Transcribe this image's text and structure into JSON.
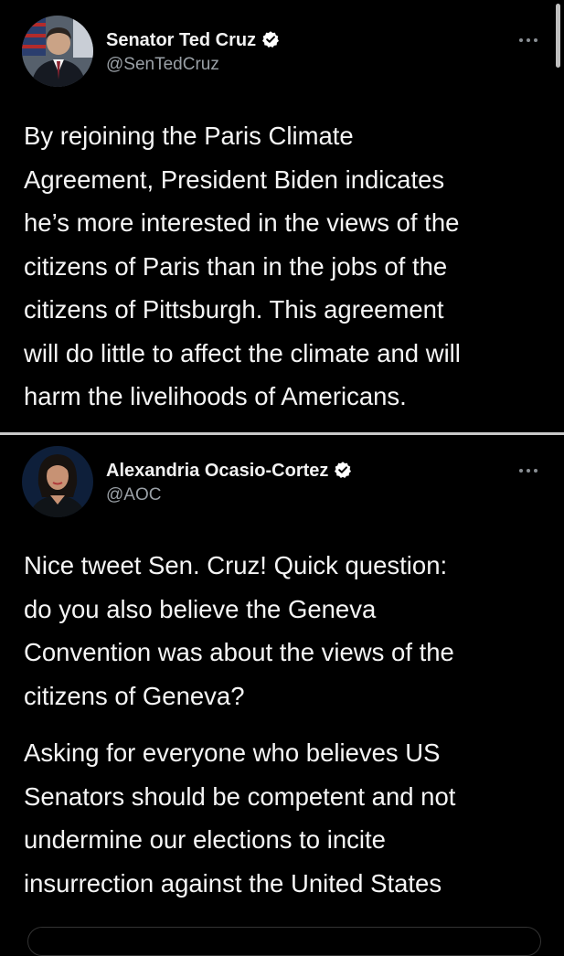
{
  "tweets": [
    {
      "author": {
        "name": "Senator Ted Cruz",
        "handle": "@SenTedCruz",
        "verified": true
      },
      "paragraphs": [
        "By rejoining the Paris Climate\nAgreement, President Biden indicates\nhe’s more interested in the views of the\ncitizens of Paris than in the jobs of the\ncitizens of Pittsburgh. This agreement\nwill do little to affect the climate and will\nharm the livelihoods of Americans."
      ]
    },
    {
      "author": {
        "name": "Alexandria Ocasio-Cortez",
        "handle": "@AOC",
        "verified": true
      },
      "paragraphs": [
        "Nice tweet Sen. Cruz! Quick question:\ndo you also believe the Geneva\nConvention was about the views of the\ncitizens of Geneva?",
        "Asking for everyone who believes US\nSenators should be competent and not\nundermine our elections to incite\ninsurrection against the United States"
      ]
    }
  ],
  "icons": {
    "verified": "verified-badge-icon",
    "more": "more-options-icon"
  },
  "colors": {
    "background": "#000000",
    "text_primary": "#f5f5f5",
    "text_secondary": "#9aa0a6",
    "divider": "#c8c8c8"
  }
}
